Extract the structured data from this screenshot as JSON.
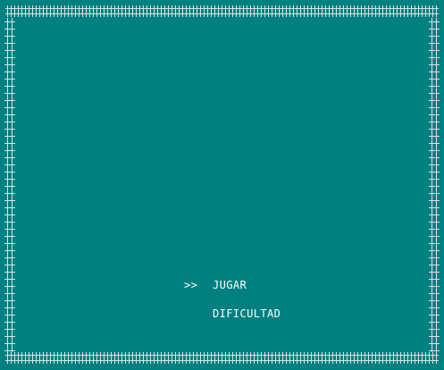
{
  "colors": {
    "background": "#008080",
    "border": "#d8e4e4",
    "text": "#ffffff"
  },
  "menu": {
    "cursor": ">>",
    "selected_index": 0,
    "options": [
      {
        "label": "JUGAR"
      },
      {
        "label": "DIFICULTAD"
      }
    ]
  }
}
